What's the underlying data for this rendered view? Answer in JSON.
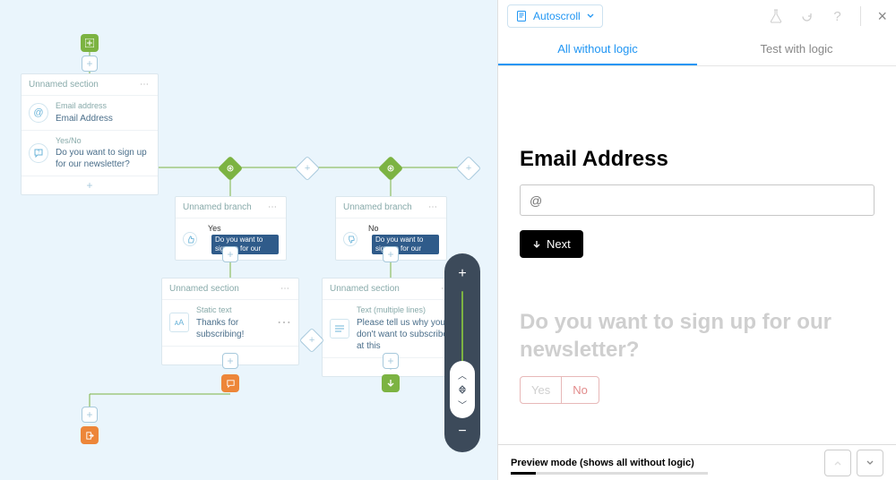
{
  "canvas": {
    "section1": {
      "title": "Unnamed section",
      "q1": {
        "label": "Email address",
        "value": "Email Address"
      },
      "q2": {
        "label": "Yes/No",
        "value": "Do you want to sign up for our newsletter?"
      }
    },
    "branch_yes": {
      "title": "Unnamed branch",
      "answer": "Yes",
      "chip": "Do you want to sign up for our"
    },
    "branch_no": {
      "title": "Unnamed branch",
      "answer": "No",
      "chip": "Do you want to sign up for our"
    },
    "section_yes": {
      "title": "Unnamed section",
      "row_label": "Static text",
      "row_value": "Thanks for subscribing!"
    },
    "section_no": {
      "title": "Unnamed section",
      "row_label": "Text (multiple lines)",
      "row_value": "Please tell us why you don't want to subscribe at this"
    }
  },
  "panel": {
    "autoscroll": "Autoscroll",
    "tabs": {
      "all": "All without logic",
      "test": "Test with logic"
    },
    "q1": {
      "title": "Email Address",
      "placeholder": "@",
      "next": "Next"
    },
    "q2": {
      "title": "Do you want to sign up for our newsletter?",
      "yes": "Yes",
      "no": "No"
    },
    "bottom": "Preview mode (shows all without logic)"
  }
}
